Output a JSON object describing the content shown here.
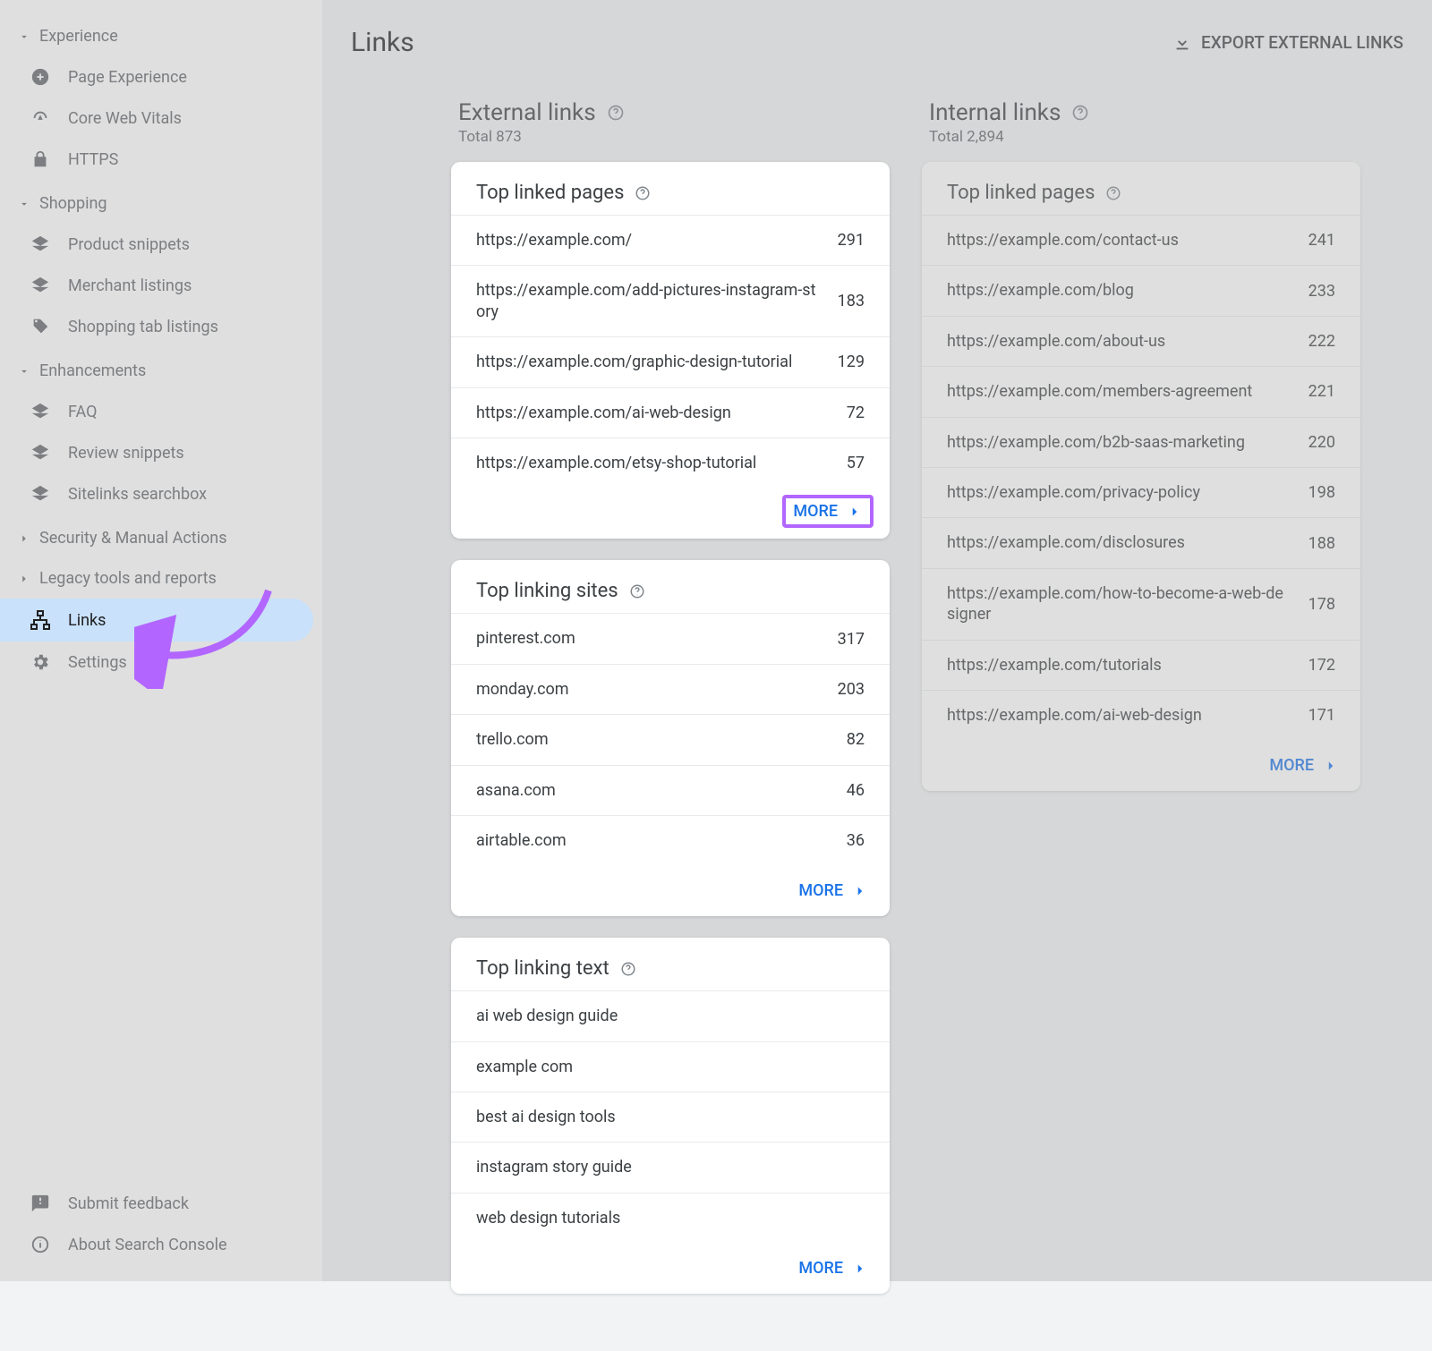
{
  "sidebar": {
    "groups": [
      {
        "label": "Experience",
        "items": [
          {
            "label": "Page Experience"
          },
          {
            "label": "Core Web Vitals"
          },
          {
            "label": "HTTPS"
          }
        ]
      },
      {
        "label": "Shopping",
        "items": [
          {
            "label": "Product snippets"
          },
          {
            "label": "Merchant listings"
          },
          {
            "label": "Shopping tab listings"
          }
        ]
      },
      {
        "label": "Enhancements",
        "items": [
          {
            "label": "FAQ"
          },
          {
            "label": "Review snippets"
          },
          {
            "label": "Sitelinks searchbox"
          }
        ]
      }
    ],
    "collapsed": [
      {
        "label": "Security & Manual Actions"
      },
      {
        "label": "Legacy tools and reports"
      }
    ],
    "links_label": "Links",
    "settings_label": "Settings",
    "footer": {
      "feedback": "Submit feedback",
      "about": "About Search Console"
    }
  },
  "page": {
    "title": "Links",
    "export_label": "EXPORT EXTERNAL LINKS"
  },
  "external": {
    "title": "External links",
    "total": "Total 873",
    "top_pages_title": "Top linked pages",
    "more": "MORE",
    "top_pages": [
      {
        "url": "https://example.com/",
        "count": "291"
      },
      {
        "url": "https://example.com/add-pictures-instagram-story",
        "count": "183"
      },
      {
        "url": "https://example.com/graphic-design-tutorial",
        "count": "129"
      },
      {
        "url": "https://example.com/ai-web-design",
        "count": "72"
      },
      {
        "url": "https://example.com/etsy-shop-tutorial",
        "count": "57"
      }
    ],
    "top_sites_title": "Top linking sites",
    "top_sites": [
      {
        "url": "pinterest.com",
        "count": "317"
      },
      {
        "url": "monday.com",
        "count": "203"
      },
      {
        "url": "trello.com",
        "count": "82"
      },
      {
        "url": "asana.com",
        "count": "46"
      },
      {
        "url": "airtable.com",
        "count": "36"
      }
    ],
    "top_text_title": "Top linking text",
    "top_text": [
      {
        "url": "ai web design guide"
      },
      {
        "url": "example com"
      },
      {
        "url": "best ai design tools"
      },
      {
        "url": "instagram story guide"
      },
      {
        "url": "web design tutorials"
      }
    ]
  },
  "internal": {
    "title": "Internal links",
    "total": "Total 2,894",
    "top_pages_title": "Top linked pages",
    "more": "MORE",
    "top_pages": [
      {
        "url": "https://example.com/contact-us",
        "count": "241"
      },
      {
        "url": "https://example.com/blog",
        "count": "233"
      },
      {
        "url": "https://example.com/about-us",
        "count": "222"
      },
      {
        "url": "https://example.com/members-agreement",
        "count": "221"
      },
      {
        "url": "https://example.com/b2b-saas-marketing",
        "count": "220"
      },
      {
        "url": "https://example.com/privacy-policy",
        "count": "198"
      },
      {
        "url": "https://example.com/disclosures",
        "count": "188"
      },
      {
        "url": "https://example.com/how-to-become-a-web-designer",
        "count": "178"
      },
      {
        "url": "https://example.com/tutorials",
        "count": "172"
      },
      {
        "url": "https://example.com/ai-web-design",
        "count": "171"
      }
    ]
  }
}
